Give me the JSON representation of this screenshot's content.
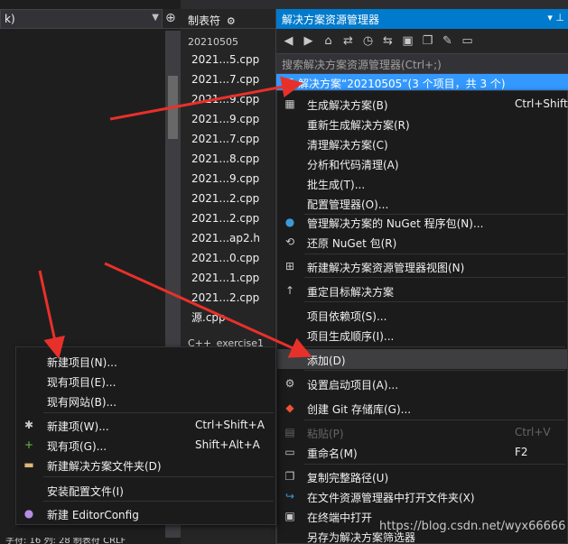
{
  "editor": {
    "dropdown_value": "k)",
    "split_icon": "split-icon"
  },
  "tabs_panel": {
    "title": "制表符",
    "group1": "20210505",
    "items": [
      "2021...5.cpp",
      "2021...7.cpp",
      "2021...9.cpp",
      "2021...9.cpp",
      "2021...7.cpp",
      "2021...8.cpp",
      "2021...9.cpp",
      "2021...2.cpp",
      "2021...2.cpp",
      "2021...ap2.h",
      "2021...0.cpp",
      "2021...1.cpp",
      "2021...2.cpp",
      "源.cpp"
    ],
    "group2": "C++_exercise1"
  },
  "solution_explorer": {
    "title": "解决方案资源管理器",
    "search_placeholder": "搜索解决方案资源管理器(Ctrl+;)",
    "solution_row": "解决方案“20210505”(3 个项目，共 3 个)",
    "colors": {
      "title_bg": "#007acc",
      "selected_bg": "#3399ff"
    }
  },
  "context_menu": {
    "items": [
      {
        "label": "生成解决方案(B)",
        "shortcut": "Ctrl+Shift+",
        "icon": "build-icon"
      },
      {
        "label": "重新生成解决方案(R)",
        "shortcut": "",
        "icon": ""
      },
      {
        "label": "清理解决方案(C)",
        "shortcut": "",
        "icon": ""
      },
      {
        "label": "分析和代码清理(A)",
        "shortcut": "",
        "icon": ""
      },
      {
        "label": "批生成(T)...",
        "shortcut": "",
        "icon": ""
      },
      {
        "label": "配置管理器(O)...",
        "shortcut": "",
        "icon": ""
      },
      {
        "label": "管理解决方案的 NuGet 程序包(N)...",
        "shortcut": "",
        "icon": "nuget-icon"
      },
      {
        "label": "还原 NuGet 包(R)",
        "shortcut": "",
        "icon": "restore-icon"
      },
      {
        "label": "新建解决方案资源管理器视图(N)",
        "shortcut": "",
        "icon": "new-view-icon"
      },
      {
        "label": "重定目标解决方案",
        "shortcut": "",
        "icon": "retarget-icon"
      },
      {
        "label": "项目依赖项(S)...",
        "shortcut": "",
        "icon": ""
      },
      {
        "label": "项目生成顺序(I)...",
        "shortcut": "",
        "icon": ""
      },
      {
        "label": "添加(D)",
        "shortcut": "",
        "icon": ""
      },
      {
        "label": "设置启动项目(A)...",
        "shortcut": "",
        "icon": "gear-icon"
      },
      {
        "label": "创建 Git 存储库(G)...",
        "shortcut": "",
        "icon": "git-icon"
      },
      {
        "label": "粘贴(P)",
        "shortcut": "Ctrl+V",
        "icon": "paste-icon"
      },
      {
        "label": "重命名(M)",
        "shortcut": "F2",
        "icon": "rename-icon"
      },
      {
        "label": "复制完整路径(U)",
        "shortcut": "",
        "icon": "copy-icon"
      },
      {
        "label": "在文件资源管理器中打开文件夹(X)",
        "shortcut": "",
        "icon": "open-folder-icon"
      },
      {
        "label": "在终端中打开",
        "shortcut": "",
        "icon": "terminal-icon"
      },
      {
        "label": "另存为解决方案筛选器",
        "shortcut": "",
        "icon": ""
      }
    ]
  },
  "add_submenu": {
    "items": [
      {
        "label": "新建项目(N)...",
        "shortcut": "",
        "icon": ""
      },
      {
        "label": "现有项目(E)...",
        "shortcut": "",
        "icon": ""
      },
      {
        "label": "现有网站(B)...",
        "shortcut": "",
        "icon": ""
      },
      {
        "label": "新建项(W)...",
        "shortcut": "Ctrl+Shift+A",
        "icon": "new-item-icon"
      },
      {
        "label": "现有项(G)...",
        "shortcut": "Shift+Alt+A",
        "icon": "existing-item-icon"
      },
      {
        "label": "新建解决方案文件夹(D)",
        "shortcut": "",
        "icon": "folder-icon"
      },
      {
        "label": "安装配置文件(I)",
        "shortcut": "",
        "icon": ""
      },
      {
        "label": "新建 EditorConfig",
        "shortcut": "",
        "icon": "editorconfig-icon"
      }
    ]
  },
  "status_bar": {
    "text": "字符: 16    列: 28    制表符    CRLF"
  },
  "watermark": "https://blog.csdn.net/wyx66666",
  "annotation_color": "#e8302a"
}
